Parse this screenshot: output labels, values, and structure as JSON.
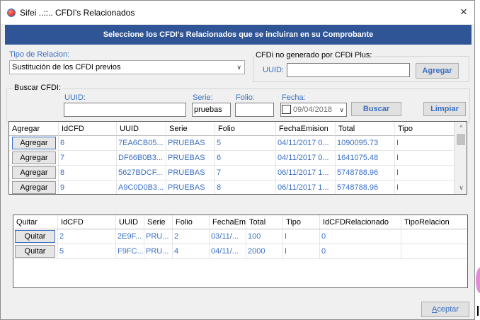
{
  "window": {
    "title": "Sifei ..::.. CFDI's Relacionados",
    "close_icon": "×"
  },
  "banner": {
    "text": "Seleccione los CFDI's Relacionados que se incluiran en su Comprobante"
  },
  "tipo_relacion": {
    "label": "Tipo de Relacion:",
    "selected": "Sustitución de los CFDI previos",
    "arrow": "∨"
  },
  "cfdi_no_generado": {
    "group_title": "CFDi no generado por CFDi Plus:",
    "uuid_label": "UUID:",
    "uuid_value": "",
    "agregar_label": "Agregar"
  },
  "buscar": {
    "group_title": "Buscar CFDI:",
    "uuid_label": "UUID:",
    "uuid_value": "",
    "serie_label": "Serie:",
    "serie_value": "pruebas",
    "folio_label": "Folio:",
    "folio_value": "",
    "fecha_label": "Fecha:",
    "fecha_value": "09/04/2018",
    "fecha_arrow": "∨",
    "buscar_label": "Buscar",
    "limpiar_label": "Limpiar"
  },
  "results_grid": {
    "headers": [
      "Agregar",
      "IdCFD",
      "UUID",
      "Serie",
      "Folio",
      "FechaEmision",
      "Total",
      "Tipo"
    ],
    "button_label": "Agregar",
    "rows": [
      {
        "idcfd": "6",
        "uuid": "7EA6CB05...",
        "serie": "PRUEBAS",
        "folio": "5",
        "fecha": "04/11/2017 0...",
        "total": "1090095.73",
        "tipo": "I"
      },
      {
        "idcfd": "7",
        "uuid": "DF66B0B3...",
        "serie": "PRUEBAS",
        "folio": "6",
        "fecha": "04/11/2017 0...",
        "total": "1641075.48",
        "tipo": "I"
      },
      {
        "idcfd": "8",
        "uuid": "5627BDCF...",
        "serie": "PRUEBAS",
        "folio": "7",
        "fecha": "06/11/2017 1...",
        "total": "5748788.96",
        "tipo": "I"
      },
      {
        "idcfd": "9",
        "uuid": "A9C0D0B3...",
        "serie": "PRUEBAS",
        "folio": "8",
        "fecha": "06/11/2017 1...",
        "total": "5748788.96",
        "tipo": "I"
      }
    ],
    "scroll_up": "^",
    "scroll_down": "∨"
  },
  "related_grid": {
    "headers": [
      "Quitar",
      "IdCFD",
      "UUID",
      "Serie",
      "Folio",
      "FechaEm",
      "Total",
      "Tipo",
      "IdCFDRelacionado",
      "TipoRelacion"
    ],
    "button_label": "Quitar",
    "rows": [
      {
        "idcfd": "2",
        "uuid": "2E9F...",
        "serie": "PRU...",
        "folio": "2",
        "fecha": "03/11/...",
        "total": "100",
        "tipo": "I",
        "idrel": "0",
        "tiporel": ""
      },
      {
        "idcfd": "5",
        "uuid": "F9FC...",
        "serie": "PRU...",
        "folio": "4",
        "fecha": "04/11/...",
        "total": "2000",
        "tipo": "I",
        "idrel": "0",
        "tiporel": ""
      }
    ]
  },
  "footer": {
    "aceptar_accel": "A",
    "aceptar_rest": "ceptar"
  },
  "colors": {
    "banner": "#2f5597",
    "accent_text": "#3a6fc4"
  }
}
